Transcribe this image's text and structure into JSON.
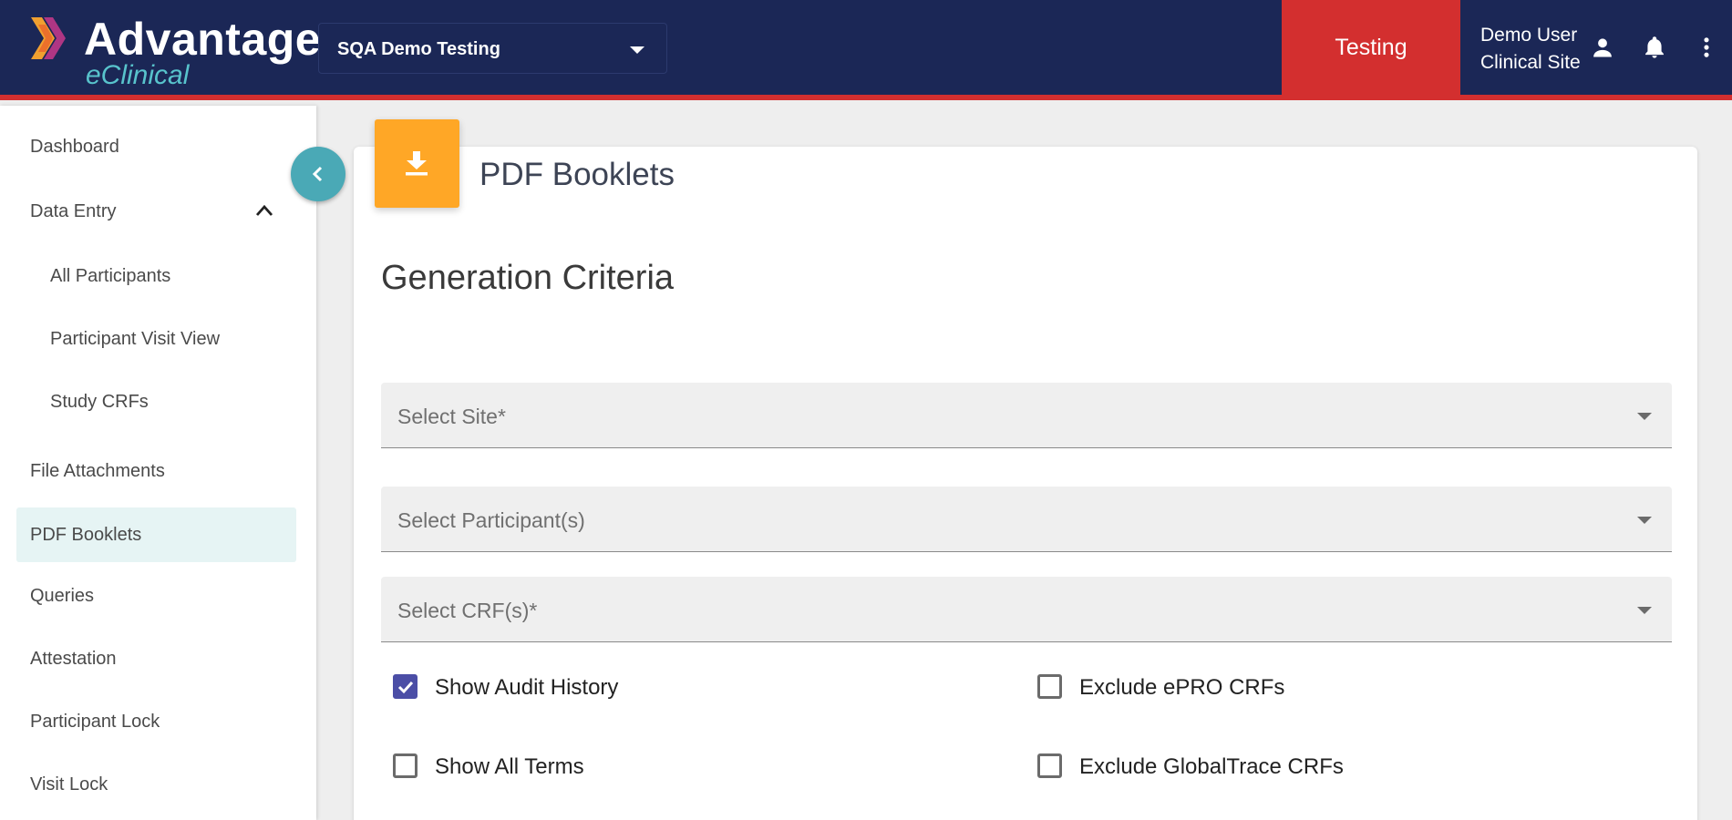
{
  "header": {
    "logo_title": "Advantage",
    "logo_subtitle": "eClinical",
    "study_select_value": "SQA Demo Testing",
    "environment_label": "Testing",
    "user_name": "Demo User",
    "user_role": "Clinical Site",
    "colors": {
      "header_bg": "#1b2756",
      "environment_bg": "#d32f2f",
      "accent_teal": "#58c3cc"
    },
    "icons": [
      "user-icon",
      "bell-icon",
      "more-vert-icon"
    ]
  },
  "sidebar": {
    "items": [
      {
        "label": "Dashboard"
      },
      {
        "label": "Data Entry",
        "expanded": true
      },
      {
        "label": "All Participants"
      },
      {
        "label": "Participant Visit View"
      },
      {
        "label": "Study CRFs"
      },
      {
        "label": "File Attachments"
      },
      {
        "label": "PDF Booklets",
        "active": true
      },
      {
        "label": "Queries"
      },
      {
        "label": "Attestation"
      },
      {
        "label": "Participant Lock"
      },
      {
        "label": "Visit Lock"
      }
    ]
  },
  "main": {
    "page_title": "PDF Booklets",
    "section_title": "Generation Criteria",
    "fields": [
      {
        "placeholder": "Select Site*"
      },
      {
        "placeholder": "Select Participant(s)"
      },
      {
        "placeholder": "Select CRF(s)*"
      }
    ],
    "checkboxes": [
      {
        "label": "Show Audit History",
        "checked": true
      },
      {
        "label": "Exclude ePRO CRFs",
        "checked": false
      },
      {
        "label": "Show All Terms",
        "checked": false
      },
      {
        "label": "Exclude GlobalTrace CRFs",
        "checked": false
      }
    ],
    "colors": {
      "download_tile": "#ffa726",
      "checkbox_checked": "#4b4ea6"
    }
  }
}
